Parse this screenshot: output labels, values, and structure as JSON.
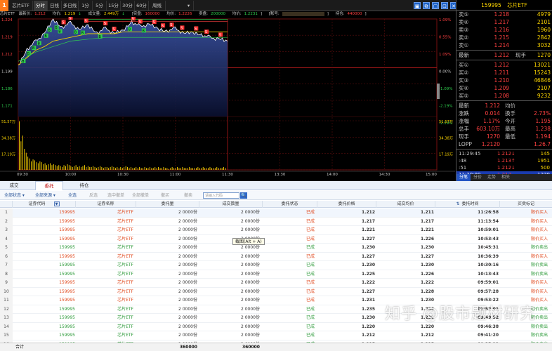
{
  "toolbar": {
    "logo": "1",
    "stock_name": "芯片ETF",
    "tabs": [
      "分时",
      "日线",
      "多日线",
      "1分",
      "5分",
      "15分",
      "30分",
      "60分",
      "周线"
    ],
    "window_buttons": [
      "▣",
      "⧉",
      "▢",
      "⊡",
      "✕"
    ]
  },
  "info": {
    "name": "芯片ETF",
    "latest_label": "最新价:",
    "latest_value": "1.212",
    "avg_label": "均价:",
    "avg_value": "1.219",
    "vol_label": "成交量:",
    "vol_value": "2.449万",
    "real_label": "[实盘:",
    "real_value": "160000",
    "real_avg_label": "均价:",
    "real_avg_value": "1.2226",
    "sell_label": "卖盘:",
    "sell_value": "200000",
    "sell_avg_label": "均价:",
    "sell_avg_value": "1.2231",
    "account_label": "[账号:",
    "account_value": "",
    "hold_label": "持仓:",
    "hold_value": "440000"
  },
  "axes": {
    "price_left": [
      "1.224",
      "1.219",
      "1.212",
      "1.199",
      "1.186",
      "1.171"
    ],
    "pct_right": [
      "1.09%",
      "0.55%",
      "1.09%",
      "0.00%",
      "-1.09%",
      "-2.19%",
      "-2.19%"
    ],
    "vol_left": [
      "51.57万",
      "34.38万",
      "17.19万"
    ],
    "vol_right": [
      "51.57万",
      "34.38万",
      "17.19万"
    ],
    "time": [
      "09:30",
      "10:30",
      "11:30",
      "13:30",
      "14:30",
      "15:00"
    ],
    "time_minor": [
      "10:00",
      "11:00",
      "14:00"
    ]
  },
  "chart_data": {
    "type": "line",
    "title": "",
    "xlabel": "",
    "ylabel": "",
    "x_range": [
      "09:30",
      "15:00"
    ],
    "ylim": [
      1.171,
      1.224
    ],
    "series": [
      {
        "values_time": [
          "09:30",
          "09:35",
          "09:40",
          "09:45",
          "09:50",
          "09:55",
          "10:00",
          "10:05",
          "10:10",
          "10:15",
          "10:20",
          "10:25",
          "10:30",
          "10:35",
          "10:40",
          "10:45",
          "10:50",
          "10:55",
          "11:00",
          "11:05",
          "11:10",
          "11:15",
          "11:20",
          "11:25",
          "11:30"
        ],
        "values": [
          1.199,
          1.207,
          1.212,
          1.216,
          1.224,
          1.219,
          1.222,
          1.218,
          1.221,
          1.216,
          1.219,
          1.216,
          1.218,
          1.222,
          1.22,
          1.221,
          1.219,
          1.217,
          1.219,
          1.216,
          1.217,
          1.215,
          1.214,
          1.213,
          1.212
        ],
        "color": "#ffffff"
      },
      {
        "values_time": [
          "09:30",
          "09:35",
          "09:40",
          "09:45",
          "09:50",
          "09:55",
          "10:00",
          "10:05",
          "10:10",
          "10:15",
          "10:20",
          "10:25",
          "10:30",
          "10:35",
          "10:40",
          "10:45",
          "10:50",
          "10:55",
          "11:00",
          "11:05",
          "11:10",
          "11:15",
          "11:20",
          "11:25",
          "11:30"
        ],
        "values": [
          1.199,
          1.203,
          1.207,
          1.209,
          1.212,
          1.213,
          1.214,
          1.215,
          1.216,
          1.216,
          1.216,
          1.216,
          1.217,
          1.217,
          1.217,
          1.217,
          1.217,
          1.217,
          1.217,
          1.217,
          1.217,
          1.217,
          1.217,
          1.217,
          1.217
        ],
        "color": "#f0d000"
      }
    ],
    "volume": [
      51,
      30,
      36,
      22,
      18,
      14,
      12,
      9,
      11,
      10,
      8,
      7,
      9,
      8,
      6,
      7,
      5,
      6,
      7,
      5,
      6,
      5,
      4,
      5,
      4,
      3,
      5,
      4,
      6,
      5,
      4,
      3,
      4,
      5,
      3,
      4,
      3,
      4,
      5,
      3,
      4,
      3,
      3,
      4,
      3,
      2,
      3,
      4,
      3,
      2,
      3,
      3,
      2,
      3,
      4,
      3,
      2,
      3,
      2,
      3,
      2,
      3,
      4,
      3,
      2,
      3,
      2,
      2,
      3,
      2,
      3,
      2,
      2,
      3,
      2,
      2,
      3,
      2,
      2,
      3,
      2,
      3,
      2,
      2,
      3,
      2,
      2,
      1,
      2,
      3,
      2,
      2,
      3,
      2,
      2,
      3,
      2,
      2,
      2,
      3,
      2,
      2,
      2,
      2,
      3,
      2,
      2,
      3,
      2,
      2,
      2,
      3,
      2,
      2,
      2,
      3,
      2,
      2,
      2,
      3,
      2
    ],
    "markers": {
      "buy": [
        "09:33",
        "09:36",
        "09:39",
        "09:42",
        "09:46",
        "09:48",
        "09:52",
        "09:54",
        "10:03",
        "10:07",
        "10:17",
        "10:34",
        "10:42"
      ],
      "sell": [
        "09:56",
        "10:00",
        "10:09",
        "10:20",
        "10:25",
        "10:36",
        "10:40",
        "10:48",
        "10:53",
        "10:58",
        "11:04",
        "11:12",
        "11:18",
        "11:26"
      ]
    },
    "reference_lines": {
      "real_avg": 1.2226,
      "sell_avg": 1.2231
    },
    "grid": true,
    "legend": ""
  },
  "quote": {
    "title_code": "159995",
    "title_name": "芯片ETF",
    "asks": [
      {
        "label": "卖⑤",
        "price": "1.218",
        "vol": "4979"
      },
      {
        "label": "卖④",
        "price": "1.217",
        "vol": "2101"
      },
      {
        "label": "卖③",
        "price": "1.216",
        "vol": "1960"
      },
      {
        "label": "卖②",
        "price": "1.215",
        "vol": "2842"
      },
      {
        "label": "卖①",
        "price": "1.214",
        "vol": "3032"
      }
    ],
    "latest_label": "最新",
    "latest_price": "1.212",
    "now_label": "现手",
    "now_value": "1270",
    "bids": [
      {
        "label": "买①",
        "price": "1.212",
        "vol": "13021"
      },
      {
        "label": "买②",
        "price": "1.211",
        "vol": "15243"
      },
      {
        "label": "买③",
        "price": "1.210",
        "vol": "46846"
      },
      {
        "label": "买④",
        "price": "1.209",
        "vol": "2107"
      },
      {
        "label": "买⑤",
        "price": "1.208",
        "vol": "9232"
      }
    ],
    "stats": [
      {
        "l1": "最新",
        "v1": "1.212",
        "l2": "均价",
        "v2": ""
      },
      {
        "l1": "涨跌",
        "v1": "0.014",
        "l2": "换手",
        "v2": "2.73%"
      },
      {
        "l1": "涨幅",
        "v1": "1.17%",
        "l2": "今开",
        "v2": "1.195"
      },
      {
        "l1": "总手",
        "v1": "603.10万",
        "l2": "最高",
        "v2": "1.238"
      },
      {
        "l1": "现手",
        "v1": "1270",
        "l2": "最低",
        "v2": "1.194"
      },
      {
        "l1": "LOPP",
        "v1": "1.2120",
        "l2": "",
        "v2": "1.26.7"
      }
    ],
    "ticks": [
      {
        "time": "11:29:45",
        "price": "1.212↓",
        "vol": "145"
      },
      {
        "time": ":48",
        "price": "1.213↑",
        "vol": "1951"
      },
      {
        "time": ":51",
        "price": "1.212↓",
        "vol": "500"
      },
      {
        "time": "11:30:00",
        "price": "1.212",
        "vol": "1270"
      }
    ],
    "tabs": [
      "分笔",
      "分价",
      "走势",
      "相关"
    ]
  },
  "lower": {
    "tabs": [
      "成交",
      "委托",
      "持仓"
    ],
    "filters": {
      "status": "全部状态 ▾",
      "source": "全部来源 ▾",
      "select_all": "全选",
      "invert": "反选",
      "cancel_selected": "选中撤单",
      "cancel_all": "全部撤单",
      "cancel_buy": "撤买",
      "cancel_sell": "撤卖",
      "search_placeholder": "请输入代码",
      "search_icon": "🔍"
    },
    "headers": [
      "证券代码",
      "证券名称",
      "委托量",
      "成交数量",
      "委托状态",
      "委托价格",
      "成交均价",
      "委托时间",
      "买卖标记"
    ],
    "header_icon": "▼",
    "sort_icon": "⇅",
    "rows": [
      {
        "idx": "1",
        "code": "159995",
        "name": "芯片ETF",
        "qty": "2 0000份",
        "dqty": "2 0000份",
        "status": "已成",
        "price": "1.212",
        "avg": "1.211",
        "time": "11:26:58",
        "flag": "限价买入",
        "side": "buy"
      },
      {
        "idx": "2",
        "code": "159995",
        "name": "芯片ETF",
        "qty": "2 0000份",
        "dqty": "2 0000份",
        "status": "已成",
        "price": "1.217",
        "avg": "1.217",
        "time": "11:13:54",
        "flag": "限价买入",
        "side": "buy"
      },
      {
        "idx": "3",
        "code": "159995",
        "name": "芯片ETF",
        "qty": "2 0000份",
        "dqty": "2 0000份",
        "status": "已成",
        "price": "1.221",
        "avg": "1.221",
        "time": "10:59:01",
        "flag": "限价买入",
        "side": "buy"
      },
      {
        "idx": "4",
        "code": "159995",
        "name": "芯片ETF",
        "qty": "2 0000份",
        "dqty": "2 0000份",
        "status": "已成",
        "price": "1.227",
        "avg": "1.226",
        "time": "10:53:43",
        "flag": "限价买入",
        "side": "buy"
      },
      {
        "idx": "5",
        "code": "159995",
        "name": "芯片ETF",
        "qty": "2 0000份",
        "dqty": "2 0000份",
        "status": "已成",
        "price": "1.230",
        "avg": "1.230",
        "time": "10:45:31",
        "flag": "限价卖出",
        "side": "sell"
      },
      {
        "idx": "6",
        "code": "159995",
        "name": "芯片ETF",
        "qty": "2 0000份",
        "dqty": "2 0000份",
        "status": "已成",
        "price": "1.227",
        "avg": "1.227",
        "time": "10:36:39",
        "flag": "限价买入",
        "side": "buy"
      },
      {
        "idx": "7",
        "code": "159995",
        "name": "芯片ETF",
        "qty": "2 0000份",
        "dqty": "2 0000份",
        "status": "已成",
        "price": "1.230",
        "avg": "1.230",
        "time": "10:30:16",
        "flag": "限价卖出",
        "side": "sell"
      },
      {
        "idx": "8",
        "code": "159995",
        "name": "芯片ETF",
        "qty": "2 0000份",
        "dqty": "2 0000份",
        "status": "已成",
        "price": "1.225",
        "avg": "1.226",
        "time": "10:13:43",
        "flag": "限价卖出",
        "side": "sell"
      },
      {
        "idx": "9",
        "code": "159995",
        "name": "芯片ETF",
        "qty": "2 0000份",
        "dqty": "2 0000份",
        "status": "已成",
        "price": "1.222",
        "avg": "1.222",
        "time": "09:59:01",
        "flag": "限价买入",
        "side": "buy"
      },
      {
        "idx": "10",
        "code": "159995",
        "name": "芯片ETF",
        "qty": "2 0000份",
        "dqty": "2 0000份",
        "status": "已成",
        "price": "1.227",
        "avg": "1.228",
        "time": "09:57:28",
        "flag": "限价买入",
        "side": "buy"
      },
      {
        "idx": "11",
        "code": "159995",
        "name": "芯片ETF",
        "qty": "2 0000份",
        "dqty": "2 0000份",
        "status": "已成",
        "price": "1.231",
        "avg": "1.230",
        "time": "09:53:22",
        "flag": "限价买入",
        "side": "buy"
      },
      {
        "idx": "12",
        "code": "159995",
        "name": "芯片ETF",
        "qty": "2 0000份",
        "dqty": "2 0000份",
        "status": "已成",
        "price": "1.235",
        "avg": "1.236",
        "time": "09:52:01",
        "flag": "限价卖出",
        "side": "sell"
      },
      {
        "idx": "13",
        "code": "159995",
        "name": "芯片ETF",
        "qty": "2 0000份",
        "dqty": "2 0000份",
        "status": "已成",
        "price": "1.230",
        "avg": "1.230",
        "time": "09:49:52",
        "flag": "限价卖出",
        "side": "sell"
      },
      {
        "idx": "14",
        "code": "159995",
        "name": "芯片ETF",
        "qty": "2 0000份",
        "dqty": "2 0000份",
        "status": "已成",
        "price": "1.220",
        "avg": "1.220",
        "time": "09:46:38",
        "flag": "限价卖出",
        "side": "sell"
      },
      {
        "idx": "15",
        "code": "159995",
        "name": "芯片ETF",
        "qty": "2 0000份",
        "dqty": "2 0000份",
        "status": "已成",
        "price": "1.212",
        "avg": "1.212",
        "time": "09:41:20",
        "flag": "限价卖出",
        "side": "sell"
      },
      {
        "idx": "16",
        "code": "159995",
        "name": "芯片ETF",
        "qty": "2 0000份",
        "dqty": "2 0000份",
        "status": "已成",
        "price": "1.215",
        "avg": "1.215",
        "time": "09:35:12",
        "flag": "限价卖出",
        "side": "sell"
      }
    ],
    "summary_label": "合计",
    "summary_qty": "360000",
    "summary_dqty": "360000"
  },
  "tooltip": "截图(Alt + A)",
  "watermark": "知乎 @股市题材研究"
}
